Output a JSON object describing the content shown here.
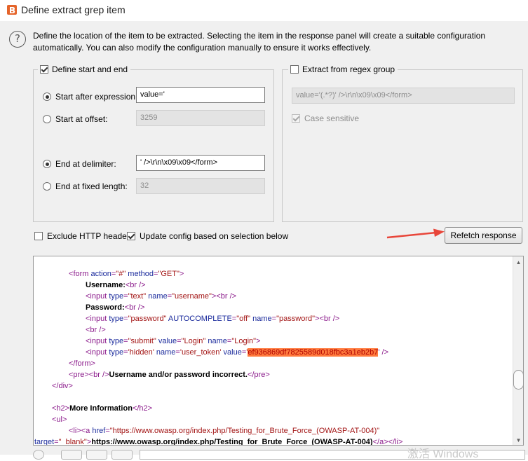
{
  "window": {
    "title": "Define extract grep item",
    "app_icon": "burp-suite-icon"
  },
  "description": "Define the location of the item to be extracted. Selecting the item in the response panel will create a suitable configuration automatically. You can also modify the configuration manually to ensure it works effectively.",
  "start_end": {
    "label": "Define start and end",
    "checked": true,
    "start_after_expression": {
      "label": "Start after expression:",
      "value": "value='",
      "selected": true
    },
    "start_at_offset": {
      "label": "Start at offset:",
      "value": "3259",
      "selected": false
    },
    "end_at_delimiter": {
      "label": "End at delimiter:",
      "value": "' />\\r\\n\\x09\\x09</form>",
      "selected": true
    },
    "end_at_fixed_length": {
      "label": "End at fixed length:",
      "value": "32",
      "selected": false
    }
  },
  "regex_group": {
    "label": "Extract from regex group",
    "checked": false,
    "pattern": "value='(.*?)' />\\r\\n\\x09\\x09</form>",
    "case_sensitive_label": "Case sensitive",
    "case_sensitive_checked": true
  },
  "options": {
    "exclude_headers_label": "Exclude HTTP headers",
    "exclude_headers_checked": false,
    "update_config_label": "Update config based on selection below",
    "update_config_checked": true
  },
  "refetch_button": "Refetch response",
  "annotation_color": "#e8463a",
  "highlight_color": "#ff7a3d",
  "response": {
    "form_open": {
      "tag": "form",
      "action_attr": "action",
      "action_val": "\"#\"",
      "method_attr": "method",
      "method_val": "\"GET\""
    },
    "username_label": "Username:",
    "br": "<br />",
    "input_username": {
      "type_attr": "type",
      "type_val": "\"text\"",
      "name_attr": "name",
      "name_val": "\"username\""
    },
    "password_label": "Password:",
    "input_password": {
      "type_attr": "type",
      "type_val": "\"password\"",
      "autocomplete_attr": "AUTOCOMPLETE",
      "autocomplete_val": "\"off\"",
      "name_attr": "name",
      "name_val": "\"password\""
    },
    "input_submit": {
      "type_attr": "type",
      "type_val": "\"submit\"",
      "value_attr": "value",
      "value_val": "\"Login\"",
      "name_attr": "name",
      "name_val": "\"Login\""
    },
    "input_hidden": {
      "type_attr": "type",
      "type_val": "'hidden'",
      "name_attr": "name",
      "name_val": "'user_token'",
      "value_attr": "value",
      "quote": "'",
      "token": "ef936869df7825589d018fbc3a1eb2b7",
      "close": "' />"
    },
    "form_close": "</form>",
    "pre_open": "<pre>",
    "pre_message": "Username and/or password incorrect.",
    "pre_close": "</pre>",
    "div_close": "</div>",
    "h2_open": "<h2>",
    "h2_text": "More Information",
    "h2_close": "</h2>",
    "ul_open": "<ul>",
    "li_open": "<li>",
    "a_href_attr": "href",
    "a_href_val": "\"https://www.owasp.org/index.php/Testing_for_Brute_Force_(OWASP-AT-004)\"",
    "a_target_attr": "target",
    "a_target_val": "\"_blank\"",
    "a_text": "https://www.owasp.org/index.php/Testing_for_Brute_Force_(OWASP-AT-004)",
    "a_close": "</a>",
    "li_close": "</li>"
  },
  "watermark": "激活 Windows"
}
